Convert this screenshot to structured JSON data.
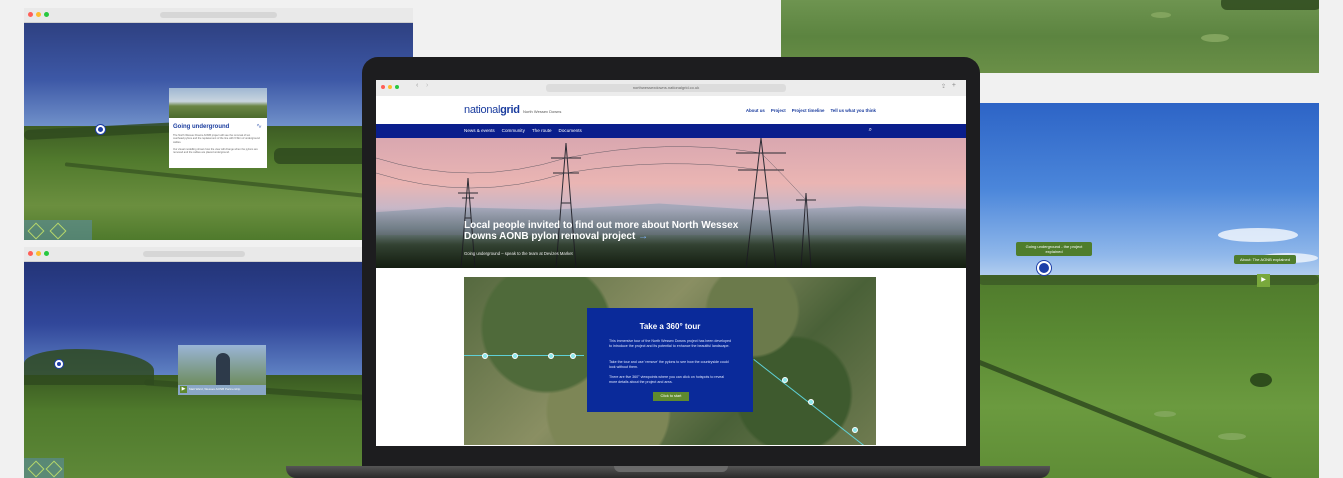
{
  "left_top_pano": {
    "card_title": "Going underground",
    "card_body_1": "The North Wessex Downs AONB project will see the removal of ten overhead pylons and the replacement of the line with 6.5km of underground cables.",
    "card_body_2": "Our visual modelling shows how the view will change when the pylons are removed and the cables are placed underground."
  },
  "left_bottom_pano": {
    "video_caption": "Matt Ward, Wessex AONB Partnership"
  },
  "laptop": {
    "url": "northwessexdowns.nationalgrid.co.uk",
    "logo_main": "national",
    "logo_bold": "grid",
    "logo_sub": "North Wessex Downs",
    "topnav": [
      "About us",
      "Project",
      "Project timeline",
      "Tell us what you think"
    ],
    "bluenav": [
      "News & events",
      "Community",
      "The route",
      "Documents"
    ],
    "hero_title": "Local people invited to find out more about North Wessex Downs AONB pylon removal project",
    "hero_arrow": "→",
    "hero_sub": "Going underground – speak to the team at Devizes Market",
    "tour": {
      "title": "Take a 360° tour",
      "p1": "This immersive tour of the North Wessex Downs project has been developed to introduce the project and its potential to enhance the beautiful landscape.",
      "p2": "Take the tour and use 'remove' the pylons to see how the countryside could look without them.",
      "p3": "There are five 360° viewpoints where you can click on hotspots to reveal more details about the project and area.",
      "button": "Click to start"
    }
  },
  "right_pano": {
    "label_left": "Going underground - the project explained",
    "label_right": "About: The AONB explained",
    "play_icon": "▶"
  },
  "colors": {
    "brand_blue": "#0a1e8c",
    "tour_blue": "#0a2a9a",
    "accent_green": "#5f8a2e",
    "route_cyan": "#5fd0d6"
  }
}
